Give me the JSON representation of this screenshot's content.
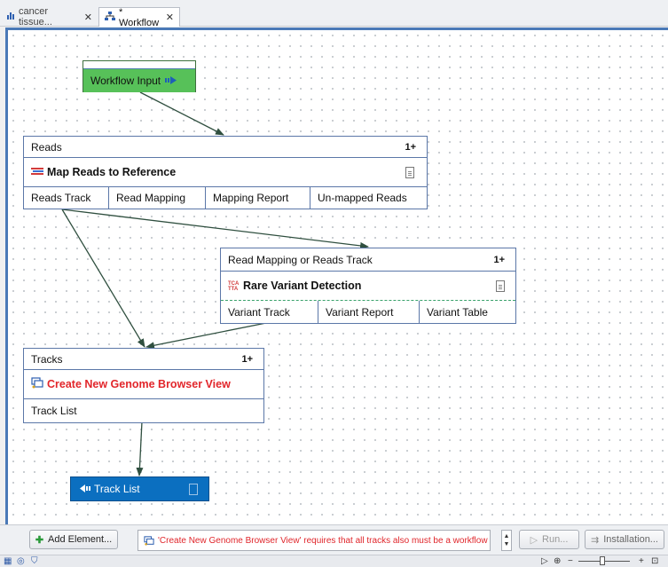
{
  "tabs": [
    {
      "label": "cancer tissue...",
      "icon": "bar-chart-icon",
      "active": false
    },
    {
      "label": "* Workflow",
      "icon": "workflow-icon",
      "active": true
    }
  ],
  "workflow_input": {
    "label": "Workflow Input"
  },
  "nodes": {
    "map_reads": {
      "input_label": "Reads",
      "input_count": "1+",
      "title": "Map Reads to Reference",
      "ports": [
        "Reads Track",
        "Read Mapping",
        "Mapping Report",
        "Un-mapped Reads"
      ]
    },
    "rare_variant": {
      "input_label": "Read Mapping or Reads Track",
      "input_count": "1+",
      "title": "Rare Variant Detection",
      "ports": [
        "Variant Track",
        "Variant Report",
        "Variant Table"
      ]
    },
    "genome_browser": {
      "input_label": "Tracks",
      "input_count": "1+",
      "title": "Create New Genome Browser View",
      "ports": [
        "Track List"
      ]
    }
  },
  "output": {
    "label": "Track List"
  },
  "bottom": {
    "add_element": "Add Element...",
    "message": "'Create New Genome Browser View' requires that all tracks also must be a workflow output",
    "run": "Run...",
    "installation": "Installation..."
  },
  "colors": {
    "input_green": "#57c159",
    "output_blue": "#0b6fc0",
    "error_red": "#e0262b",
    "node_border": "#5b77a8"
  }
}
